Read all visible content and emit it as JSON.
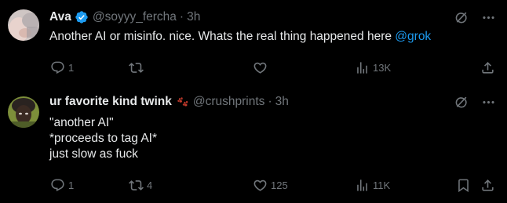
{
  "tweets": [
    {
      "name": "Ava",
      "handle": "@soyyy_fercha",
      "separator": "·",
      "time": "3h",
      "text_plain": "Another AI or misinfo. nice. Whats the real thing happened here ",
      "mention": "@grok",
      "replies": "1",
      "retweets": "",
      "likes": "",
      "views": "13K",
      "verified": true,
      "icons": [
        "avatar",
        "verified-badge-icon",
        "grok-actions-icon",
        "more-icon",
        "reply-icon",
        "retweet-icon",
        "like-icon",
        "views-icon",
        "share-icon"
      ]
    },
    {
      "name": "ur favorite kind twink",
      "handle": "@crushprints",
      "separator": "·",
      "time": "3h",
      "lines": [
        "\"another AI\"",
        "*proceeds to tag AI*",
        "just slow as fuck"
      ],
      "replies": "1",
      "retweets": "4",
      "likes": "125",
      "views": "11K",
      "verified": false,
      "icons": [
        "avatar",
        "paw-prints-emoji-icon",
        "grok-actions-icon",
        "more-icon",
        "reply-icon",
        "retweet-icon",
        "like-icon",
        "views-icon",
        "bookmark-icon",
        "share-icon"
      ]
    }
  ],
  "colors": {
    "background": "#000000",
    "text": "#e7e9ea",
    "muted": "#71767b",
    "accent": "#1d9bf0",
    "emoji": "#c0392b"
  }
}
